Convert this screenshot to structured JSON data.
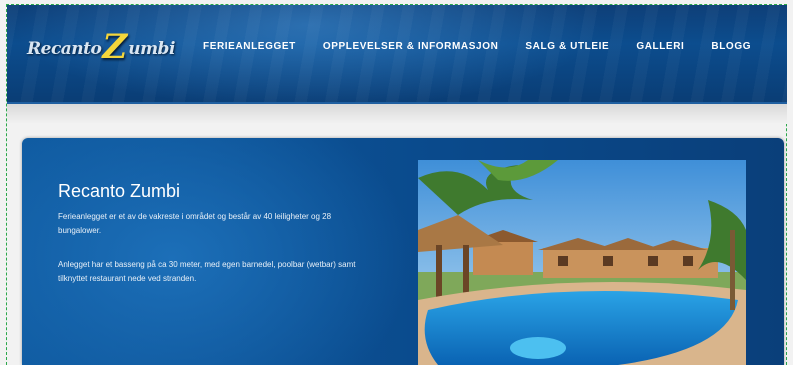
{
  "header": {
    "logo": {
      "part1": "Recanto",
      "part2": "Z",
      "part3": "umbi"
    },
    "nav": [
      {
        "label": "FERIEANLEGGET"
      },
      {
        "label": "OPPLEVELSER & INFORMASJON"
      },
      {
        "label": "SALG & UTLEIE"
      },
      {
        "label": "GALLERI"
      },
      {
        "label": "BLOGG"
      }
    ]
  },
  "main": {
    "title": "Recanto Zumbi",
    "paragraph1": "Ferieanlegget er et av de vakreste i området og består av 40 leiligheter og 28 bungalower.",
    "paragraph2": "Anlegget har et basseng på ca 30 meter, med egen barnedel, poolbar (wetbar) samt tilknyttet restaurant nede ved stranden."
  },
  "colors": {
    "header_bg": "#0c4d8e",
    "panel_bg": "#0f5aa0",
    "logo_accent": "#f4d63b",
    "text": "#ffffff"
  }
}
